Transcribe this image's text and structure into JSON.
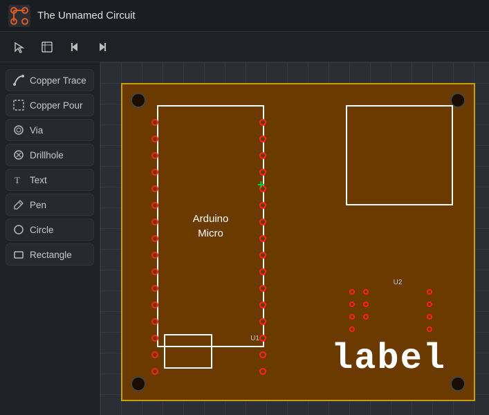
{
  "titleBar": {
    "appName": "The Unnamed Circuit"
  },
  "toolbar": {
    "buttons": [
      {
        "name": "select-tool",
        "icon": "⬚",
        "label": "Select"
      },
      {
        "name": "frame-tool",
        "icon": "⬜",
        "label": "Frame"
      },
      {
        "name": "step-back",
        "icon": "⏮",
        "label": "Step Back"
      },
      {
        "name": "step-forward",
        "icon": "⏭",
        "label": "Step Forward"
      }
    ]
  },
  "sidebar": {
    "items": [
      {
        "id": "copper-trace",
        "label": "Copper Trace"
      },
      {
        "id": "copper-pour",
        "label": "Copper Pour"
      },
      {
        "id": "via",
        "label": "Via"
      },
      {
        "id": "drillhole",
        "label": "Drillhole"
      },
      {
        "id": "text",
        "label": "Text"
      },
      {
        "id": "pen",
        "label": "Pen"
      },
      {
        "id": "circle",
        "label": "Circle"
      },
      {
        "id": "rectangle",
        "label": "Rectangle"
      }
    ]
  },
  "canvas": {
    "component1Label": "Arduino",
    "component1SubLabel": "Micro",
    "component1Ref": "U1",
    "component2Ref": "U2",
    "boardLabel": "label"
  },
  "colors": {
    "boardFill": "#6b3a00",
    "boardBorder": "#c8a000",
    "padColor": "#ff2222",
    "componentBorder": "#ffffff"
  }
}
